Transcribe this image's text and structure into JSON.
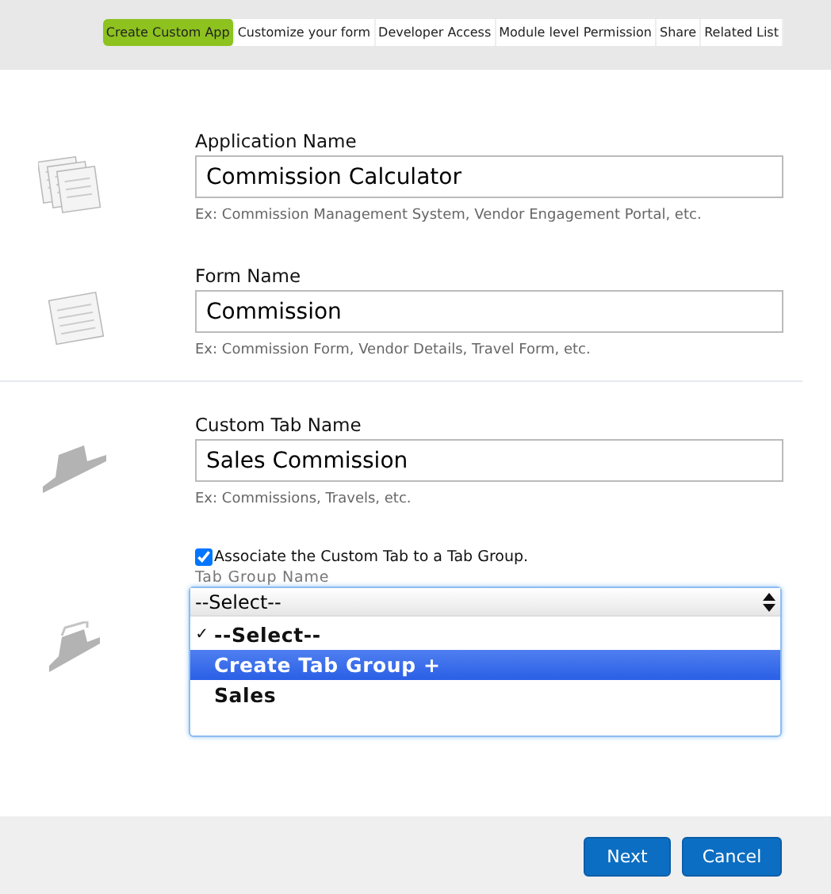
{
  "tabs": [
    {
      "label": "Create Custom App",
      "selected": true
    },
    {
      "label": "Customize your form",
      "selected": false
    },
    {
      "label": "Developer Access",
      "selected": false
    },
    {
      "label": "Module level Permission",
      "selected": false
    },
    {
      "label": "Share",
      "selected": false
    },
    {
      "label": "Related List",
      "selected": false
    }
  ],
  "sections": [
    {
      "label": "Application Name",
      "value": "Commission Calculator",
      "hint": "Ex: Commission Management System, Vendor Engagement Portal, etc."
    },
    {
      "label": "Form Name",
      "value": "Commission",
      "hint": "Ex: Commission Form, Vendor Details, Travel Form, etc."
    },
    {
      "label": "Custom Tab Name",
      "value": "Sales Commission",
      "hint": "Ex: Commissions, Travels, etc."
    }
  ],
  "tab_group": {
    "checkbox_label": "Associate the Custom Tab to a Tab Group.",
    "checked": true,
    "label": "Tab Group Name",
    "value": "--Select--",
    "tick": "✓",
    "options": [
      {
        "label": "--Select--",
        "selected": true,
        "highlighted": false
      },
      {
        "label": "Create Tab Group +",
        "selected": false,
        "highlighted": true
      },
      {
        "label": "Sales",
        "selected": false,
        "highlighted": false
      }
    ]
  },
  "buttons": [
    "Next",
    "Cancel"
  ]
}
